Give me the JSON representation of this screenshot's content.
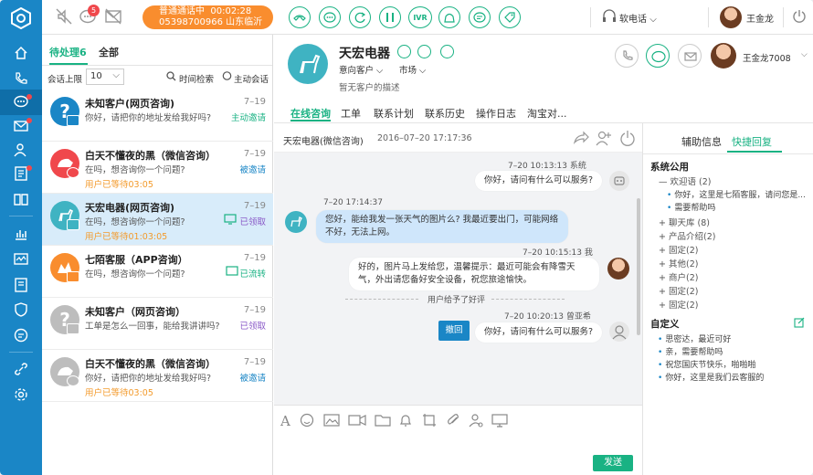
{
  "colors": {
    "sidebar": "#1a86c6",
    "accent": "#19b283",
    "orange": "#f98d2e",
    "badge": "#f0484c"
  },
  "topbar": {
    "notify_count": "5",
    "call_status": "普通通话中",
    "call_time": "00:02:28",
    "call_number": "05398700966 山东临沂",
    "ivr": "IVR",
    "softphone": "软电话",
    "user": "王金龙"
  },
  "list": {
    "tab_pending": "待处理6",
    "tab_all": "全部",
    "filter_label": "会话上限",
    "filter_value": "10",
    "time_search": "时间检索",
    "proactive": "主动会话",
    "items": [
      {
        "name": "未知客户(网页咨询)",
        "date": "7–19",
        "msg": "你好，请把你的地址发给我好吗?",
        "status": "主动邀请",
        "wait": ""
      },
      {
        "name": "白天不懂夜的黑（微信咨询）",
        "date": "7–19",
        "msg": "在吗，想咨询你一个问题?",
        "status": "被邀请",
        "wait": "用户已等待03:05"
      },
      {
        "name": "天宏电器(网页咨询)",
        "date": "7–19",
        "msg": "在吗，想咨询你一个问题?",
        "status": "已领取",
        "wait": "用户已等待01:03:05"
      },
      {
        "name": "七陌客服（APP咨询）",
        "date": "7–19",
        "msg": "在吗，想咨询你一个问题?",
        "status": "已流转",
        "wait": ""
      },
      {
        "name": "未知客户（网页咨询）",
        "date": "7–19",
        "msg": "工单是怎么一回事，能给我讲讲吗?",
        "status": "已领取",
        "wait": ""
      },
      {
        "name": "白天不懂夜的黑（微信咨询）",
        "date": "7–19",
        "msg": "你好，请把你的地址发给我好吗?",
        "status": "被邀请",
        "wait": "用户已等待03:05"
      }
    ]
  },
  "customer": {
    "name": "天宏电器",
    "tag1": "意向客户",
    "tag2": "市场",
    "desc": "暂无客户的描述",
    "agent": "王金龙7008",
    "tabs": [
      "在线咨询",
      "工单",
      "联系计划",
      "联系历史",
      "操作日志",
      "淘宝对..."
    ]
  },
  "chat": {
    "title": "天宏电器(微信咨询)",
    "datetime": "2016–07–20 17:17:36",
    "m1_meta": "7–20  10:13:13  系统",
    "m1": "你好，请问有什么可以服务?",
    "m2_meta": "7–20  17:14:37",
    "m2": "您好，能给我发一张天气的图片么? 我最近要出门，可能网络不好，无法上网。",
    "m3_meta": "7–20  10:15:13  我",
    "m3": "好的，图片马上发给您，温馨提示：最近可能会有降雪天气，外出请您备好安全设备，祝您旅途愉快。",
    "divider": "用户给予了好评",
    "m4_meta": "7–20  10:20:13  曾亚希",
    "m4": "你好，请问有什么可以服务?",
    "recall": "撤回",
    "send": "发送"
  },
  "assist": {
    "tab1": "辅助信息",
    "tab2": "快捷回复",
    "system": "系统公用",
    "welcome": "欢迎语 (2)",
    "w1": "你好，这里是七陌客服，请问您是...",
    "w2": "需要帮助吗",
    "cats": [
      "聊天库 (8)",
      "产品介绍(2)",
      "固定(2)",
      "其他(2)",
      "商户(2)",
      "固定(2)",
      "固定(2)"
    ],
    "custom": "自定义",
    "customs": [
      "思密达，最近可好",
      "亲，需要帮助吗",
      "祝您国庆节快乐，啪啪啪",
      "你好，这里是我们云客服的"
    ]
  }
}
